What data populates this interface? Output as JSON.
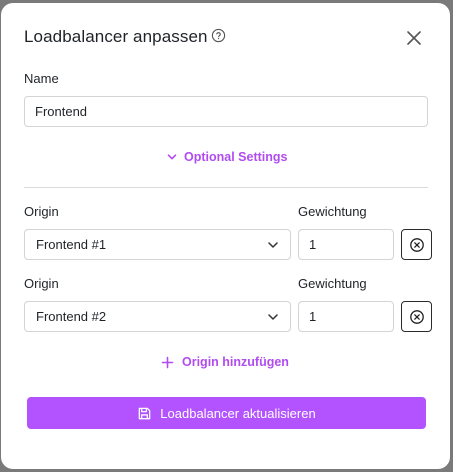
{
  "dialog": {
    "title": "Loadbalancer anpassen"
  },
  "name_field": {
    "label": "Name",
    "value": "Frontend"
  },
  "optional_settings": {
    "label": "Optional Settings"
  },
  "origins": [
    {
      "origin_label": "Origin",
      "origin_value": "Frontend #1",
      "weight_label": "Gewichtung",
      "weight_value": "1"
    },
    {
      "origin_label": "Origin",
      "origin_value": "Frontend #2",
      "weight_label": "Gewichtung",
      "weight_value": "1"
    }
  ],
  "add_origin": {
    "label": "Origin hinzufügen"
  },
  "submit": {
    "label": "Loadbalancer aktualisieren"
  },
  "colors": {
    "accent": "#b353ff",
    "accent_text": "#b14cf0",
    "overlay": "#7a7a7a"
  },
  "icons": {
    "help": "help-circle-icon",
    "close": "close-icon",
    "chevron": "chevron-down-icon",
    "remove": "x-circle-icon",
    "add": "plus-icon",
    "save": "save-icon"
  }
}
